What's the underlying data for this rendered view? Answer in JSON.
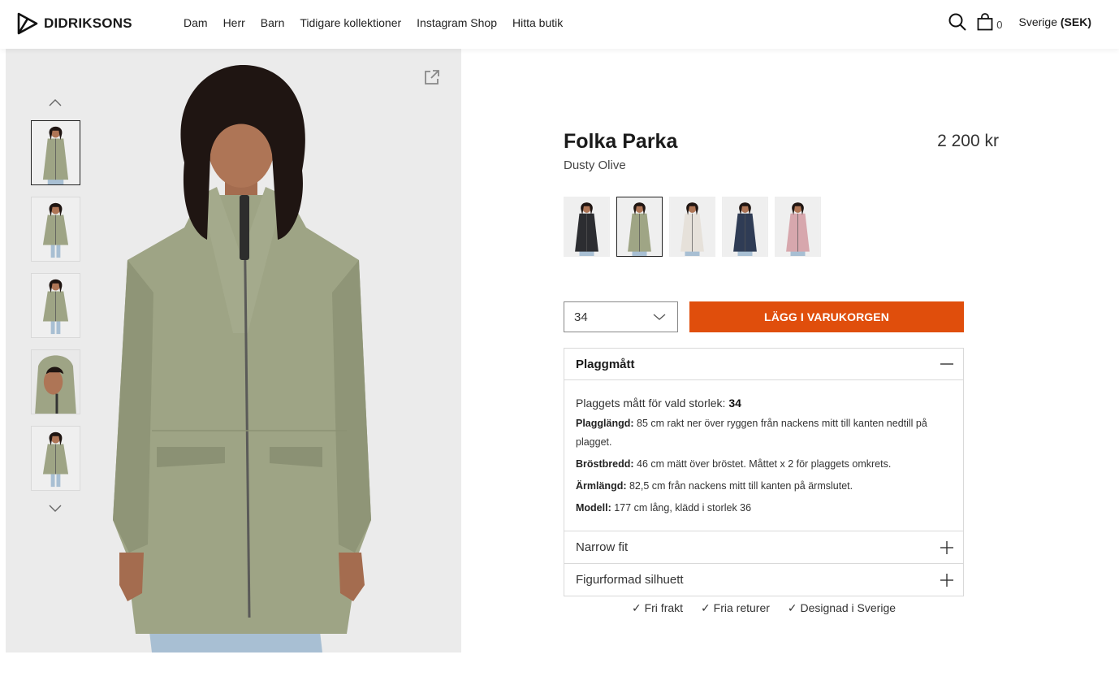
{
  "header": {
    "logo_text": "DIDRIKSONS",
    "nav": [
      "Dam",
      "Herr",
      "Barn",
      "Tidigare kollektioner",
      "Instagram Shop",
      "Hitta butik"
    ],
    "cart_count": "0",
    "region_country": "Sverige",
    "region_currency": "(SEK)"
  },
  "gallery": {
    "thumbnail_count": 5,
    "active_index": 0
  },
  "product": {
    "title": "Folka Parka",
    "price": "2 200 kr",
    "color_name": "Dusty Olive",
    "swatches": [
      {
        "color": "#2c2d31",
        "active": false
      },
      {
        "color": "#9fa585",
        "active": true
      },
      {
        "color": "#e6e1da",
        "active": false
      },
      {
        "color": "#2f3c55",
        "active": false
      },
      {
        "color": "#d7a7ad",
        "active": false
      }
    ],
    "selected_size": "34",
    "add_to_cart_label": "LÄGG I VARUKORGEN",
    "accent_color": "#e04e0c"
  },
  "measurements": {
    "heading": "Plaggmått",
    "lead_label": "Plaggets mått för vald storlek:",
    "lead_value": "34",
    "rows": [
      {
        "label": "Plagglängd:",
        "text": "85 cm rakt ner över ryggen från nackens mitt till kanten nedtill på plagget."
      },
      {
        "label": "Bröstbredd:",
        "text": "46 cm mätt över bröstet. Måttet x 2 för plaggets omkrets."
      },
      {
        "label": "Ärmlängd:",
        "text": "82,5 cm från nackens mitt till kanten på ärmslutet."
      },
      {
        "label": "Modell:",
        "text": "177 cm lång, klädd i storlek 36"
      }
    ]
  },
  "accordion_closed": [
    "Narrow fit",
    "Figurformad silhuett"
  ],
  "usps": [
    "✓ Fri frakt",
    "✓ Fria returer",
    "✓ Designad i Sverige"
  ]
}
